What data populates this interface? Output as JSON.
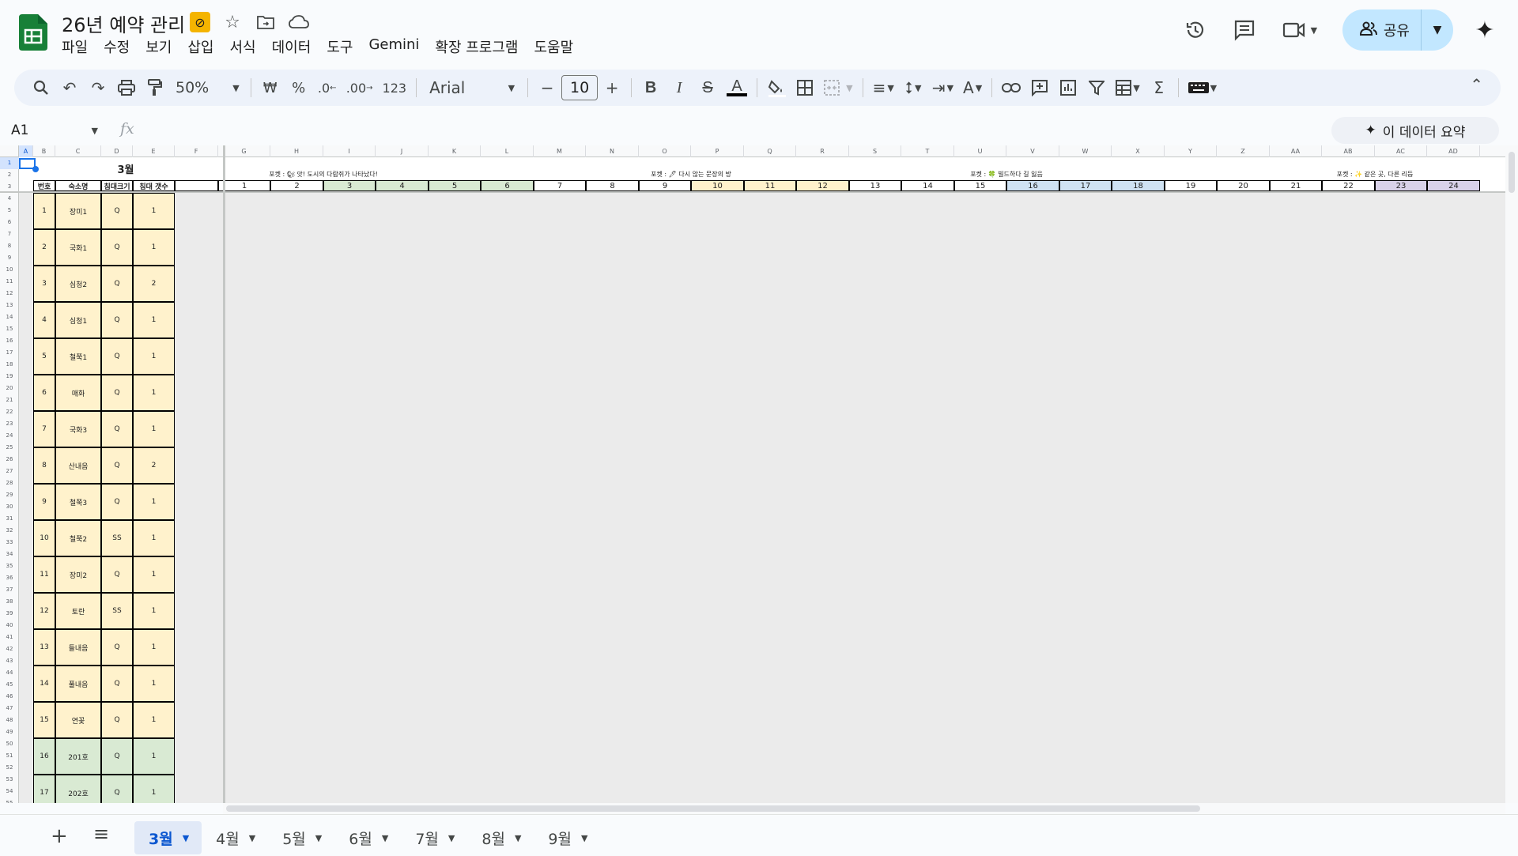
{
  "doc": {
    "title": "26년 예약 관리"
  },
  "menu": [
    "파일",
    "수정",
    "보기",
    "삽입",
    "서식",
    "데이터",
    "도구",
    "Gemini",
    "확장 프로그램",
    "도움말"
  ],
  "share": {
    "label": "공유"
  },
  "toolbar": {
    "zoom": "50%",
    "currency": "₩",
    "percent": "%",
    "dec_decrease": ".0",
    "dec_increase": ".00",
    "number_format": "123",
    "font": "Arial",
    "font_size": "10"
  },
  "formula_bar": {
    "name_box": "A1",
    "fx": "fx",
    "summary_button": "이 데이터 요약"
  },
  "grid": {
    "columns": [
      {
        "id": "A",
        "w": 18
      },
      {
        "id": "B",
        "w": 28
      },
      {
        "id": "C",
        "w": 58
      },
      {
        "id": "D",
        "w": 40
      },
      {
        "id": "E",
        "w": 53
      },
      {
        "id": "F",
        "w": 55
      },
      {
        "id": "G",
        "w": 66
      },
      {
        "id": "H",
        "w": 67
      },
      {
        "id": "I",
        "w": 66
      },
      {
        "id": "J",
        "w": 67
      },
      {
        "id": "K",
        "w": 66
      },
      {
        "id": "L",
        "w": 67
      },
      {
        "id": "M",
        "w": 66
      },
      {
        "id": "N",
        "w": 67
      },
      {
        "id": "O",
        "w": 66
      },
      {
        "id": "P",
        "w": 67
      },
      {
        "id": "Q",
        "w": 66
      },
      {
        "id": "R",
        "w": 67
      },
      {
        "id": "S",
        "w": 66
      },
      {
        "id": "T",
        "w": 67
      },
      {
        "id": "U",
        "w": 66
      },
      {
        "id": "V",
        "w": 67
      },
      {
        "id": "W",
        "w": 66
      },
      {
        "id": "X",
        "w": 67
      },
      {
        "id": "Y",
        "w": 66
      },
      {
        "id": "Z",
        "w": 67
      },
      {
        "id": "AA",
        "w": 66
      },
      {
        "id": "AB",
        "w": 67
      },
      {
        "id": "AC",
        "w": 66
      },
      {
        "id": "AD",
        "w": 67
      }
    ],
    "month_title": "3월",
    "headers": [
      "번호",
      "숙소명",
      "침대크기",
      "침대 갯수"
    ],
    "promos": [
      {
        "text": "포켓 : 🐿 앗! 도시의 다람쥐가 나타났다!",
        "col": 8
      },
      {
        "text": "포켓 : 🖊 다시 않는 문장의 방",
        "col": 15
      },
      {
        "text": "포켓 : 🍀 빌드하다 길 잃음",
        "col": 21
      },
      {
        "text": "포켓 : ✨ 같은 곳, 다른 리듬",
        "col": 28
      }
    ],
    "days": [
      {
        "n": "1",
        "c": "#ffffff"
      },
      {
        "n": "2",
        "c": "#ffffff"
      },
      {
        "n": "3",
        "c": "#d9ead3"
      },
      {
        "n": "4",
        "c": "#d9ead3"
      },
      {
        "n": "5",
        "c": "#d9ead3"
      },
      {
        "n": "6",
        "c": "#d9ead3"
      },
      {
        "n": "7",
        "c": "#ffffff"
      },
      {
        "n": "8",
        "c": "#ffffff"
      },
      {
        "n": "9",
        "c": "#ffffff"
      },
      {
        "n": "10",
        "c": "#fff2cc"
      },
      {
        "n": "11",
        "c": "#fff2cc"
      },
      {
        "n": "12",
        "c": "#fff2cc"
      },
      {
        "n": "13",
        "c": "#ffffff"
      },
      {
        "n": "14",
        "c": "#ffffff"
      },
      {
        "n": "15",
        "c": "#ffffff"
      },
      {
        "n": "16",
        "c": "#cfe2f3"
      },
      {
        "n": "17",
        "c": "#cfe2f3"
      },
      {
        "n": "18",
        "c": "#cfe2f3"
      },
      {
        "n": "19",
        "c": "#ffffff"
      },
      {
        "n": "20",
        "c": "#ffffff"
      },
      {
        "n": "21",
        "c": "#ffffff"
      },
      {
        "n": "22",
        "c": "#ffffff"
      },
      {
        "n": "23",
        "c": "#d9d2e9"
      },
      {
        "n": "24",
        "c": "#d9d2e9"
      }
    ],
    "rooms": [
      {
        "no": "1",
        "name": "장미1",
        "bed": "Q",
        "count": "1",
        "color": "#fff2cc"
      },
      {
        "no": "2",
        "name": "국화1",
        "bed": "Q",
        "count": "1",
        "color": "#fff2cc"
      },
      {
        "no": "3",
        "name": "심청2",
        "bed": "Q",
        "count": "2",
        "color": "#fff2cc"
      },
      {
        "no": "4",
        "name": "심청1",
        "bed": "Q",
        "count": "1",
        "color": "#fff2cc"
      },
      {
        "no": "5",
        "name": "철쭉1",
        "bed": "Q",
        "count": "1",
        "color": "#fff2cc"
      },
      {
        "no": "6",
        "name": "매화",
        "bed": "Q",
        "count": "1",
        "color": "#fff2cc"
      },
      {
        "no": "7",
        "name": "국화3",
        "bed": "Q",
        "count": "1",
        "color": "#fff2cc"
      },
      {
        "no": "8",
        "name": "산내음",
        "bed": "Q",
        "count": "2",
        "color": "#fff2cc"
      },
      {
        "no": "9",
        "name": "철쭉3",
        "bed": "Q",
        "count": "1",
        "color": "#fff2cc"
      },
      {
        "no": "10",
        "name": "철쭉2",
        "bed": "SS",
        "count": "1",
        "color": "#fff2cc"
      },
      {
        "no": "11",
        "name": "장미2",
        "bed": "Q",
        "count": "1",
        "color": "#fff2cc"
      },
      {
        "no": "12",
        "name": "토란",
        "bed": "SS",
        "count": "1",
        "color": "#fff2cc"
      },
      {
        "no": "13",
        "name": "들내음",
        "bed": "Q",
        "count": "1",
        "color": "#fff2cc"
      },
      {
        "no": "14",
        "name": "풀내음",
        "bed": "Q",
        "count": "1",
        "color": "#fff2cc"
      },
      {
        "no": "15",
        "name": "연꽃",
        "bed": "Q",
        "count": "1",
        "color": "#fff2cc"
      },
      {
        "no": "16",
        "name": "201호",
        "bed": "Q",
        "count": "1",
        "color": "#d9ead3"
      },
      {
        "no": "17",
        "name": "202호",
        "bed": "Q",
        "count": "1",
        "color": "#d9ead3"
      }
    ]
  },
  "sheets": [
    {
      "label": "3월",
      "active": true
    },
    {
      "label": "4월",
      "active": false
    },
    {
      "label": "5월",
      "active": false
    },
    {
      "label": "6월",
      "active": false
    },
    {
      "label": "7월",
      "active": false
    },
    {
      "label": "8월",
      "active": false
    },
    {
      "label": "9월",
      "active": false
    }
  ]
}
